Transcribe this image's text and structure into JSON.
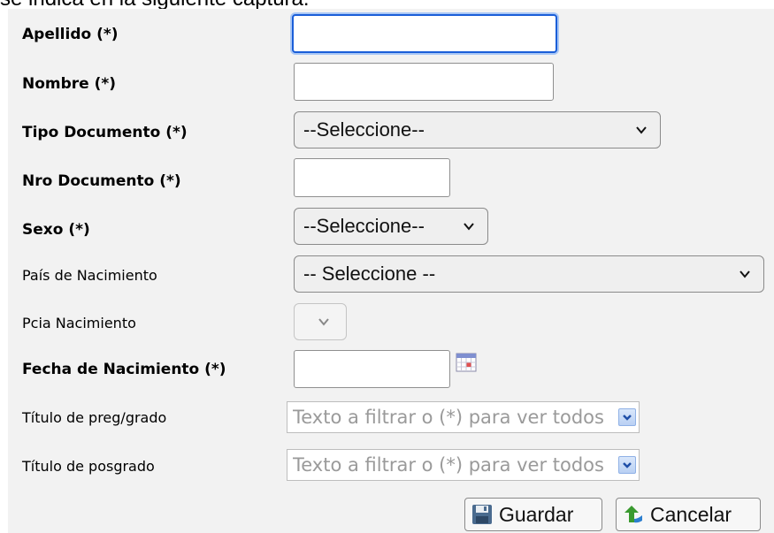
{
  "caption": "se indica en la siguiente captura:",
  "form": {
    "apellido": {
      "label": "Apellido (*)",
      "value": ""
    },
    "nombre": {
      "label": "Nombre (*)",
      "value": ""
    },
    "tipo_documento": {
      "label": "Tipo Documento (*)",
      "selected": "--Seleccione--"
    },
    "nro_documento": {
      "label": "Nro Documento (*)",
      "value": ""
    },
    "sexo": {
      "label": "Sexo (*)",
      "selected": "--Seleccione--"
    },
    "pais_nacimiento": {
      "label": "País de Nacimiento",
      "selected": "-- Seleccione --"
    },
    "pcia_nacimiento": {
      "label": "Pcia Nacimiento",
      "selected": ""
    },
    "fecha_nacimiento": {
      "label": "Fecha de Nacimiento (*)",
      "value": ""
    },
    "titulo_grado": {
      "label": "Título de preg/grado",
      "placeholder": "Texto a filtrar o (*) para ver todos"
    },
    "titulo_posgrado": {
      "label": "Título de posgrado",
      "placeholder": "Texto a filtrar o (*) para ver todos"
    }
  },
  "buttons": {
    "guardar": "Guardar",
    "cancelar": "Cancelar"
  },
  "icons": {
    "calendar": "calendar-icon",
    "save": "floppy-disk-icon",
    "cancel": "green-back-arrow-icon",
    "dropdown": "chevron-down-icon"
  },
  "colors": {
    "panel_bg": "#f2f2f2",
    "focus_border": "#1a5ed8",
    "combo_button": "#b9d0f3"
  }
}
